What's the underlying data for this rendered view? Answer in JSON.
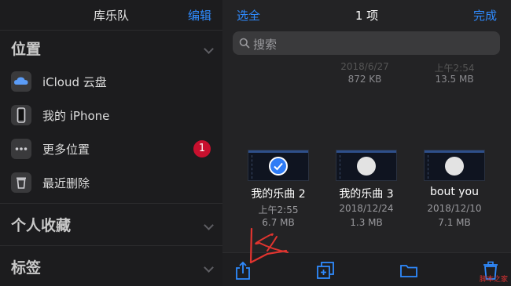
{
  "sidebar": {
    "title": "库乐队",
    "edit_label": "编辑",
    "locations_heading": "位置",
    "locations": [
      {
        "label": "iCloud 云盘",
        "icon": "icloud-drive-icon"
      },
      {
        "label": "我的 iPhone",
        "icon": "iphone-icon"
      },
      {
        "label": "更多位置",
        "icon": "more-icon",
        "badge": "1"
      },
      {
        "label": "最近删除",
        "icon": "trash-icon"
      }
    ],
    "favorites_heading": "个人收藏",
    "tags_heading": "标签"
  },
  "main": {
    "select_all_label": "选全",
    "count_label": "1 项",
    "done_label": "完成",
    "search_placeholder": "搜索",
    "ghost_row": {
      "left_date": "2018/6/27",
      "left_size": "872 KB",
      "right_date": "上午2:54",
      "right_size": "13.5 MB"
    },
    "files": [
      {
        "name": "我的乐曲 2",
        "date": "上午2:55",
        "size": "6.7 MB",
        "selected": true
      },
      {
        "name": "我的乐曲 3",
        "date": "2018/12/24",
        "size": "1.3 MB",
        "selected": false
      },
      {
        "name": "bout you",
        "date": "2018/12/10",
        "size": "7.1 MB",
        "selected": false
      }
    ],
    "toolbar": [
      "share-icon",
      "duplicate-icon",
      "folder-icon",
      "trash-icon"
    ]
  },
  "colors": {
    "accent": "#2f8bff",
    "badge": "#c8102e",
    "annotation": "#e0342f"
  },
  "watermark": "脚本之家"
}
